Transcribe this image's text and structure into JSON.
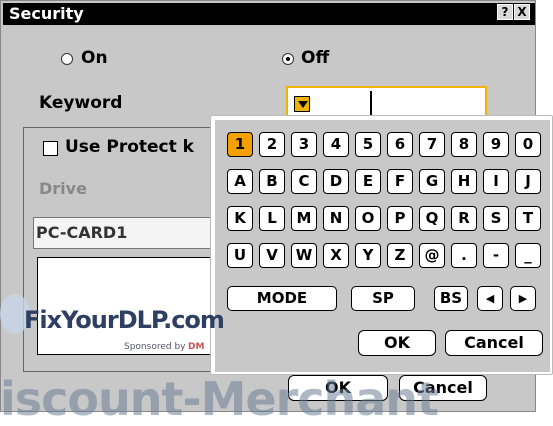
{
  "title": "Security",
  "title_buttons": {
    "help": "?",
    "close": "X"
  },
  "radios": {
    "on_label": "On",
    "off_label": "Off",
    "selected": "Off"
  },
  "keyword_label": "Keyword",
  "protect_label": "Use Protect k",
  "drive_label": "Drive",
  "drive_value": "PC-CARD1",
  "keyboard": {
    "rows": [
      [
        "1",
        "2",
        "3",
        "4",
        "5",
        "6",
        "7",
        "8",
        "9",
        "0"
      ],
      [
        "A",
        "B",
        "C",
        "D",
        "E",
        "F",
        "G",
        "H",
        "I",
        "J"
      ],
      [
        "K",
        "L",
        "M",
        "N",
        "O",
        "P",
        "Q",
        "R",
        "S",
        "T"
      ],
      [
        "U",
        "V",
        "W",
        "X",
        "Y",
        "Z",
        "@",
        ".",
        "-",
        "_"
      ]
    ],
    "selected_key": "1",
    "mode_label": "MODE",
    "sp_label": "SP",
    "bs_label": "BS",
    "left_arrow": "◀",
    "right_arrow": "▶",
    "ok_label": "OK",
    "cancel_label": "Cancel"
  },
  "dialog_buttons": {
    "ok_label": "OK",
    "cancel_label": "Cancel"
  },
  "watermark": {
    "brand": "FixYourDLP.com",
    "sponsored": "Sponsored by",
    "sponsor_logo": "DM",
    "bottom": "iscount-Merchant"
  },
  "colors": {
    "accent": "#f3a000",
    "titlebar": "#000000",
    "dialog_bg": "#c8c8c8"
  }
}
